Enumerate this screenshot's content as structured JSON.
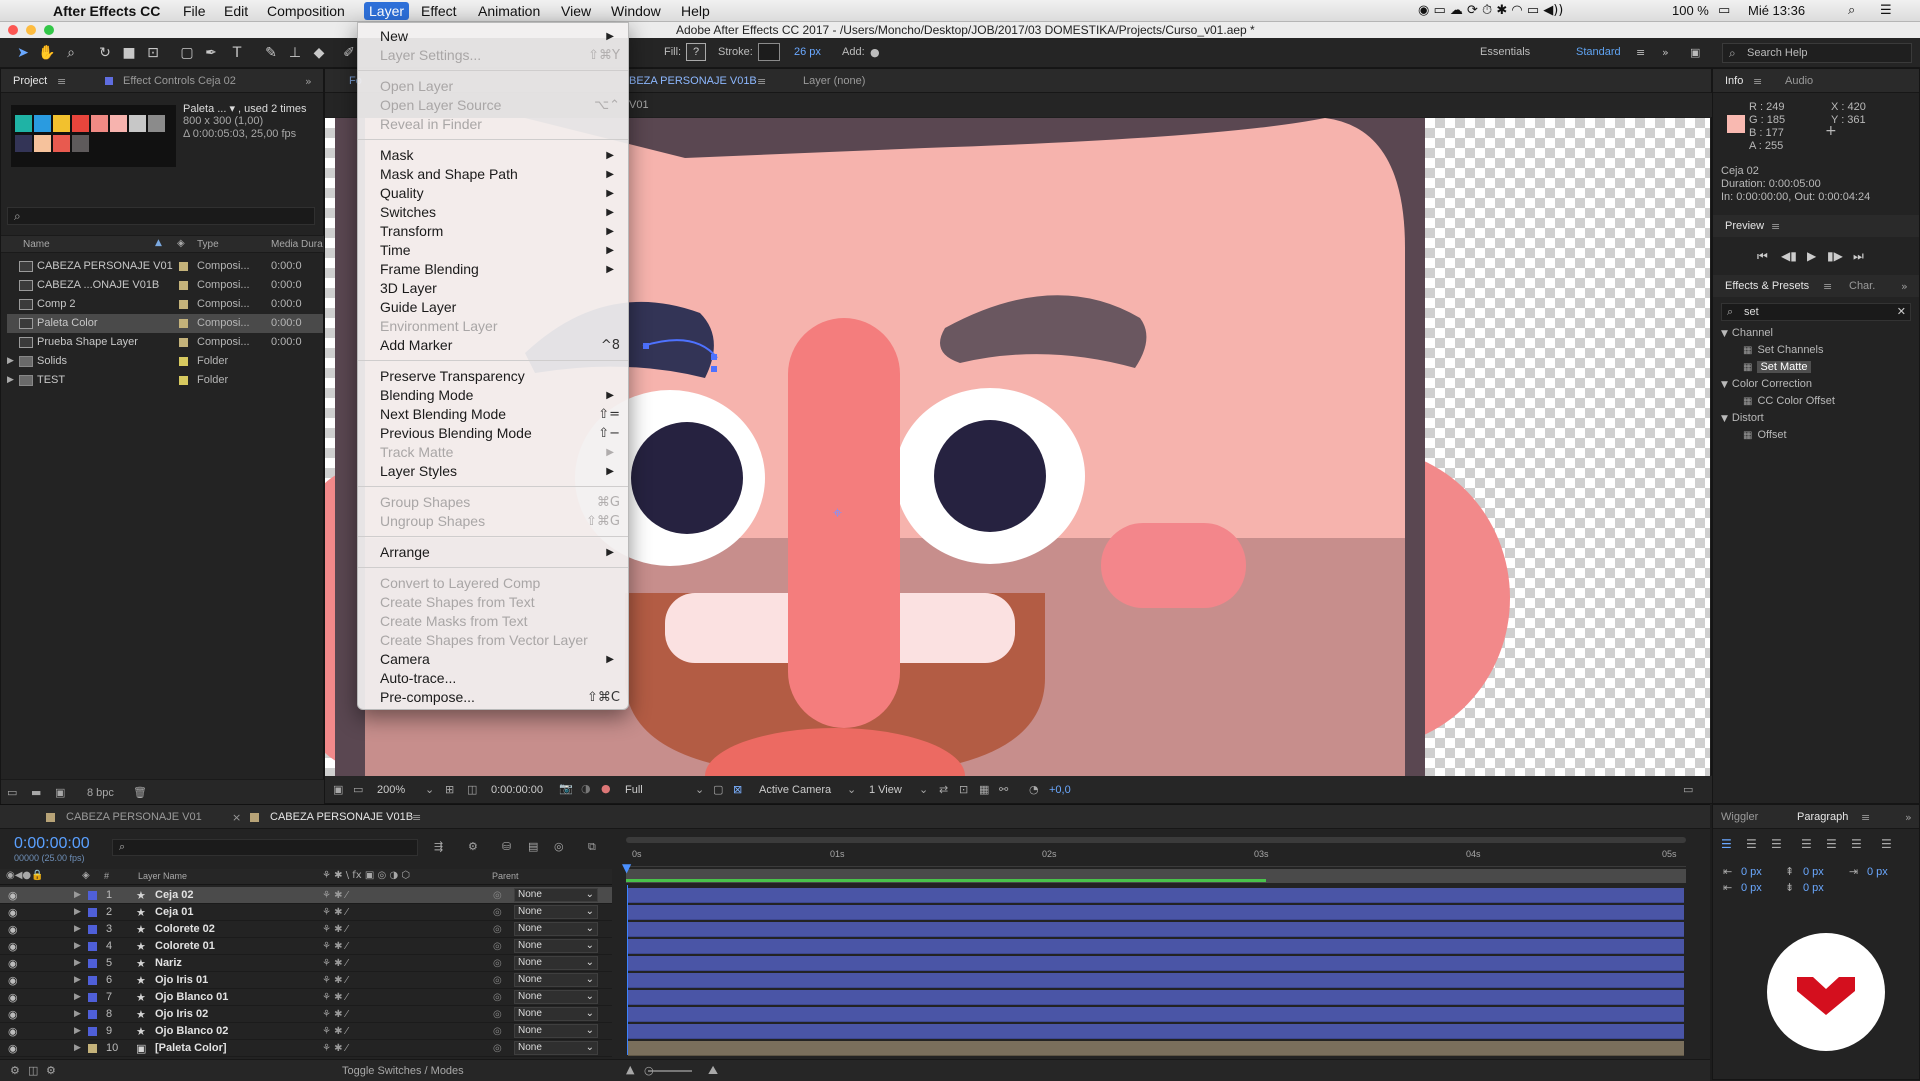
{
  "menubar": {
    "app_name": "After Effects CC",
    "items": [
      "File",
      "Edit",
      "Composition",
      "Layer",
      "Effect",
      "Animation",
      "View",
      "Window",
      "Help"
    ],
    "active": "Layer",
    "battery": "100 %",
    "clock": "Mié 13:36"
  },
  "window_title": "Adobe After Effects CC 2017 - /Users/Moncho/Desktop/JOB/2017/03 DOMESTIKA/Projects/Curso_v01.aep *",
  "toolbar": {
    "fill_label": "Fill:",
    "stroke_label": "Stroke:",
    "stroke_width": "26 px",
    "add_label": "Add:",
    "workspaces": [
      "Essentials",
      "Standard"
    ],
    "search_placeholder": "Search Help"
  },
  "project": {
    "tab": "Project",
    "effect_controls_tab": "Effect Controls Ceja 02",
    "thumb_name": "Paleta ... ▾ , used 2 times",
    "thumb_size": "800 x 300 (1,00)",
    "thumb_dur": "Δ 0:00:05:03, 25,00 fps",
    "columns": [
      "Name",
      "Type",
      "Media Dura"
    ],
    "rows": [
      {
        "name": "CABEZA PERSONAJE V01",
        "type": "Composi...",
        "dur": "0:00:0"
      },
      {
        "name": "CABEZA ...ONAJE V01B",
        "type": "Composi...",
        "dur": "0:00:0"
      },
      {
        "name": "Comp 2",
        "type": "Composi...",
        "dur": "0:00:0"
      },
      {
        "name": "Paleta Color",
        "type": "Composi...",
        "dur": "0:00:0"
      },
      {
        "name": "Prueba Shape Layer",
        "type": "Composi...",
        "dur": "0:00:0"
      },
      {
        "name": "Solids",
        "type": "Folder",
        "dur": ""
      },
      {
        "name": "TEST",
        "type": "Folder",
        "dur": ""
      }
    ],
    "selected_row": 3,
    "bpc": "8 bpc"
  },
  "viewer": {
    "comp_tab": "BEZA PERSONAJE V01B",
    "layer_tab": "Layer (none)",
    "sub_tab": "V01",
    "zoom": "200%",
    "timecode": "0:00:00:00",
    "resolution": "Full",
    "camera": "Active Camera",
    "views": "1 View",
    "exposure": "+0,0"
  },
  "layer_menu": {
    "items": [
      {
        "label": "New",
        "shortcut": "",
        "submenu": true,
        "disabled": false
      },
      {
        "label": "Layer Settings...",
        "shortcut": "⇧⌘Y",
        "submenu": false,
        "disabled": true
      },
      {
        "label": "Open Layer",
        "shortcut": "",
        "submenu": false,
        "disabled": true
      },
      {
        "label": "Open Layer Source",
        "shortcut": "⌥⌃",
        "submenu": false,
        "disabled": true
      },
      {
        "label": "Reveal in Finder",
        "shortcut": "",
        "submenu": false,
        "disabled": true
      },
      {
        "label": "Mask",
        "shortcut": "",
        "submenu": true,
        "disabled": false
      },
      {
        "label": "Mask and Shape Path",
        "shortcut": "",
        "submenu": true,
        "disabled": false
      },
      {
        "label": "Quality",
        "shortcut": "",
        "submenu": true,
        "disabled": false
      },
      {
        "label": "Switches",
        "shortcut": "",
        "submenu": true,
        "disabled": false
      },
      {
        "label": "Transform",
        "shortcut": "",
        "submenu": true,
        "disabled": false
      },
      {
        "label": "Time",
        "shortcut": "",
        "submenu": true,
        "disabled": false
      },
      {
        "label": "Frame Blending",
        "shortcut": "",
        "submenu": true,
        "disabled": false
      },
      {
        "label": "3D Layer",
        "shortcut": "",
        "submenu": false,
        "disabled": false
      },
      {
        "label": "Guide Layer",
        "shortcut": "",
        "submenu": false,
        "disabled": false
      },
      {
        "label": "Environment Layer",
        "shortcut": "",
        "submenu": false,
        "disabled": true
      },
      {
        "label": "Add Marker",
        "shortcut": "^8",
        "submenu": false,
        "disabled": false
      },
      {
        "label": "Preserve Transparency",
        "shortcut": "",
        "submenu": false,
        "disabled": false
      },
      {
        "label": "Blending Mode",
        "shortcut": "",
        "submenu": true,
        "disabled": false
      },
      {
        "label": "Next Blending Mode",
        "shortcut": "⇧=",
        "submenu": false,
        "disabled": false
      },
      {
        "label": "Previous Blending Mode",
        "shortcut": "⇧−",
        "submenu": false,
        "disabled": false
      },
      {
        "label": "Track Matte",
        "shortcut": "",
        "submenu": true,
        "disabled": true
      },
      {
        "label": "Layer Styles",
        "shortcut": "",
        "submenu": true,
        "disabled": false
      },
      {
        "label": "Group Shapes",
        "shortcut": "⌘G",
        "submenu": false,
        "disabled": true
      },
      {
        "label": "Ungroup Shapes",
        "shortcut": "⇧⌘G",
        "submenu": false,
        "disabled": true
      },
      {
        "label": "Arrange",
        "shortcut": "",
        "submenu": true,
        "disabled": false
      },
      {
        "label": "Convert to Layered Comp",
        "shortcut": "",
        "submenu": false,
        "disabled": true
      },
      {
        "label": "Create Shapes from Text",
        "shortcut": "",
        "submenu": false,
        "disabled": true
      },
      {
        "label": "Create Masks from Text",
        "shortcut": "",
        "submenu": false,
        "disabled": true
      },
      {
        "label": "Create Shapes from Vector Layer",
        "shortcut": "",
        "submenu": false,
        "disabled": true
      },
      {
        "label": "Camera",
        "shortcut": "",
        "submenu": true,
        "disabled": false
      },
      {
        "label": "Auto-trace...",
        "shortcut": "",
        "submenu": false,
        "disabled": false
      },
      {
        "label": "Pre-compose...",
        "shortcut": "⇧⌘C",
        "submenu": false,
        "disabled": false
      }
    ]
  },
  "info": {
    "tab": "Info",
    "audio_tab": "Audio",
    "r": "R : 249",
    "g": "G : 185",
    "b": "B : 177",
    "a": "A : 255",
    "x": "X : 420",
    "y": "Y : 361",
    "swatch": "#f9b9b1",
    "layer_name": "Ceja 02",
    "duration": "Duration: 0:00:05:00",
    "in_out": "In: 0:00:00:00, Out: 0:00:04:24"
  },
  "preview": {
    "title": "Preview"
  },
  "effects": {
    "tab": "Effects & Presets",
    "char_tab": "Char.",
    "search_value": "set",
    "groups": [
      {
        "name": "Channel",
        "items": [
          "Set Channels",
          "Set Matte"
        ]
      },
      {
        "name": "Color Correction",
        "items": [
          "CC Color Offset"
        ]
      },
      {
        "name": "Distort",
        "items": [
          "Offset"
        ]
      }
    ],
    "selected_item": "Set Matte"
  },
  "timeline": {
    "tabs": [
      "CABEZA PERSONAJE V01",
      "CABEZA PERSONAJE V01B"
    ],
    "timecode": "0:00:00:00",
    "frame_info": "00000 (25.00 fps)",
    "columns": {
      "layer_name": "Layer Name",
      "parent": "Parent"
    },
    "ruler": [
      "0s",
      "01s",
      "02s",
      "03s",
      "04s",
      "05s"
    ],
    "layers": [
      {
        "num": "1",
        "name": "Ceja 02",
        "parent": "None"
      },
      {
        "num": "2",
        "name": "Ceja 01",
        "parent": "None"
      },
      {
        "num": "3",
        "name": "Colorete 02",
        "parent": "None"
      },
      {
        "num": "4",
        "name": "Colorete 01",
        "parent": "None"
      },
      {
        "num": "5",
        "name": "Nariz",
        "parent": "None"
      },
      {
        "num": "6",
        "name": "Ojo Iris 01",
        "parent": "None"
      },
      {
        "num": "7",
        "name": "Ojo Blanco 01",
        "parent": "None"
      },
      {
        "num": "8",
        "name": "Ojo Iris 02",
        "parent": "None"
      },
      {
        "num": "9",
        "name": "Ojo Blanco 02",
        "parent": "None"
      },
      {
        "num": "10",
        "name": "[Paleta Color]",
        "parent": "None"
      }
    ],
    "toggle_label": "Toggle Switches / Modes"
  },
  "paragraph": {
    "wiggler_tab": "Wiggler",
    "paragraph_tab": "Paragraph",
    "indent_vals": [
      "0 px",
      "0 px",
      "0 px",
      "0 px",
      "0 px"
    ]
  },
  "palette_colors": [
    "#1fb3a5",
    "#2a9be0",
    "#f2c12e",
    "#e8453c",
    "#f08a84",
    "#f7b3ae",
    "#c7c7c7",
    "#8b8b8b",
    "#333456",
    "#f6c29c",
    "#e85a4f",
    "#5e5a5b"
  ]
}
